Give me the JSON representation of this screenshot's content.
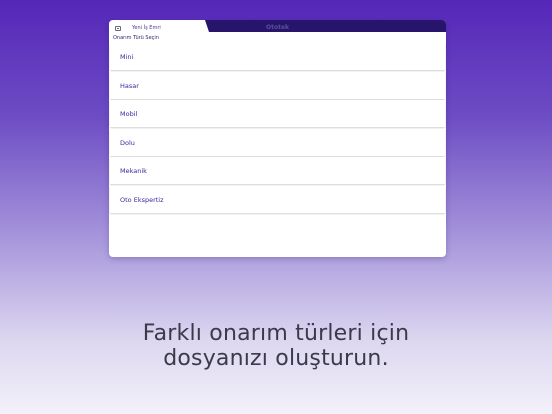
{
  "tabs": {
    "left_label": "Yeni İş Emri",
    "right_label": "Ototek"
  },
  "section_title": "Onarım Türü Seçin",
  "repair_types": [
    "Mini",
    "Hasar",
    "Mobil",
    "Dolu",
    "Mekanik",
    "Oto Ekspertiz"
  ],
  "caption": {
    "line1": "Farklı onarım türleri için",
    "line2": "dosyanızı oluşturun."
  },
  "colors": {
    "background_top": "#5527b8",
    "background_bottom": "#f3f1fa",
    "tabbar": "#26156b",
    "row_text": "#3a28a0",
    "caption_text": "#3a3a48"
  },
  "icons": {
    "new_work_order": "document-icon"
  }
}
